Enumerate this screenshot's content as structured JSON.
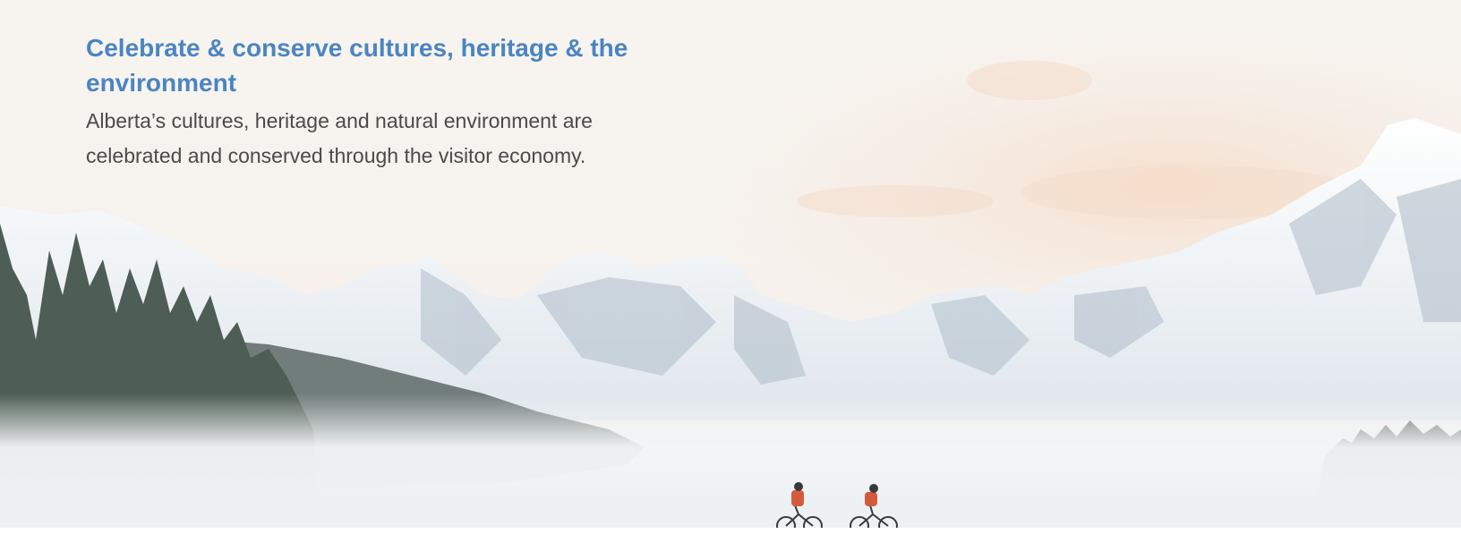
{
  "section": {
    "heading": "Celebrate & conserve cultures, heritage & the environment",
    "body": "Alberta’s cultures, heritage and natural environment are celebrated and conserved through the visitor economy."
  },
  "photo": {
    "subject": "snow-mountain-landscape-with-cyclists",
    "colors": {
      "heading": "#4a85c2",
      "body_text": "#4a4a4a",
      "sky": "#f6f3ef",
      "snow": "#eef1f3",
      "forest": "#4f5e55"
    }
  }
}
